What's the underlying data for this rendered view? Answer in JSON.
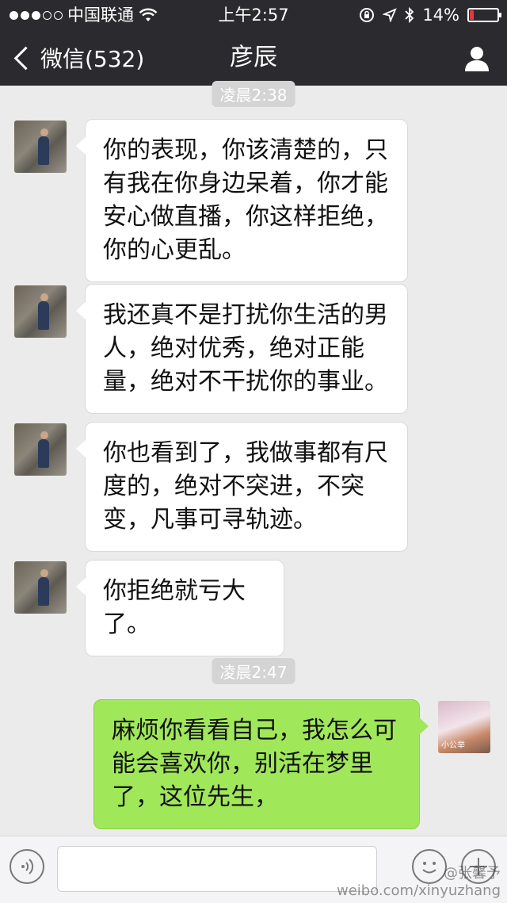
{
  "status_bar": {
    "carrier": "中国联通",
    "time": "上午2:57",
    "battery": "14%",
    "battery_level": 0.14,
    "battery_color": "#e0393e"
  },
  "nav": {
    "back_label": "微信(532)",
    "title": "彦辰",
    "profile_icon": "person-icon"
  },
  "timestamps": [
    "凌晨2:38",
    "凌晨2:47"
  ],
  "messages": [
    {
      "sender": "contact",
      "text": "你的表现，你该清楚的，只有我在你身边呆着，你才能安心做直播，你这样拒绝，你的心更乱。"
    },
    {
      "sender": "contact",
      "text": "我还真不是打扰你生活的男人，绝对优秀，绝对正能量，绝对不干扰你的事业。"
    },
    {
      "sender": "contact",
      "text": "你也看到了，我做事都有尺度的，绝对不突进，不突变，凡事可寻轨迹。"
    },
    {
      "sender": "contact",
      "text": "你拒绝就亏大了。"
    },
    {
      "sender": "self",
      "text": "麻烦你看看自己，我怎么可能会喜欢你，别活在梦里了，这位先生，",
      "bubble_color": "#a0e75a"
    }
  ],
  "self_avatar_caption": "小公举",
  "watermark": {
    "line1": "@张馨予",
    "line2": "weibo.com/xinyuzhang"
  }
}
